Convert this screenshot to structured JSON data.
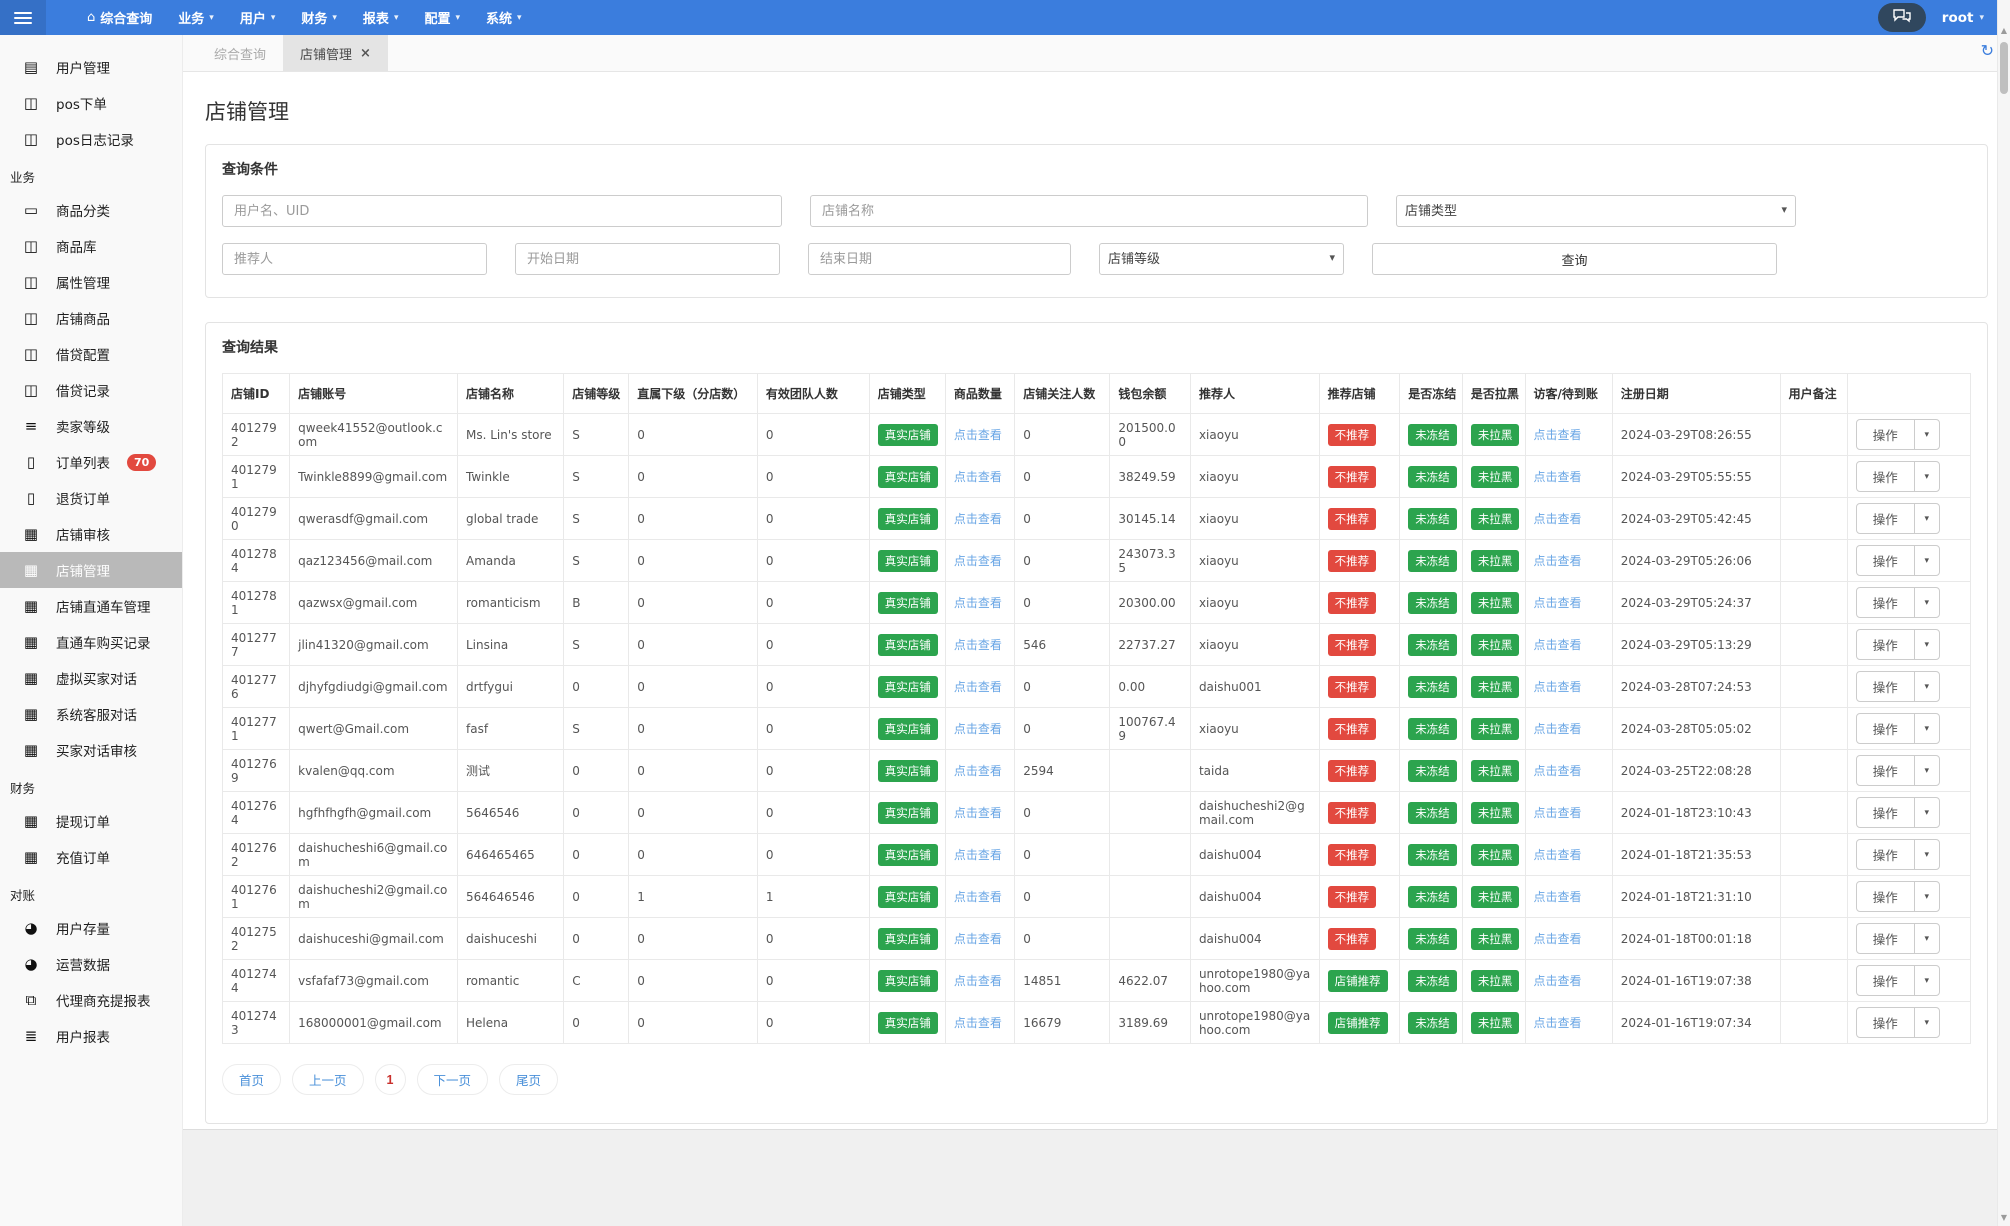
{
  "colors": {
    "navbar": "#3b7ddd",
    "badge_green": "#2ca44e",
    "badge_red": "#e2493f",
    "link": "#69a6e5",
    "pagination_link": "#4a90d9",
    "page_current": "#c9302c"
  },
  "icons": {
    "home": "⌂",
    "caret": "▾",
    "close": "×",
    "refresh": "↻",
    "arrow_up": "▲",
    "arrow_down": "▼",
    "file-icon": "▤",
    "columns-icon": "◫",
    "laptop-icon": "▭",
    "indent-icon": "≡",
    "order-icon": "▯",
    "card-icon": "▦",
    "pie-icon": "◕",
    "sitemap-icon": "⧉",
    "list-icon": "≣"
  },
  "navbar": {
    "menus": [
      {
        "label": "综合查询",
        "icon": "home",
        "caret": false
      },
      {
        "label": "业务",
        "caret": true
      },
      {
        "label": "用户",
        "caret": true
      },
      {
        "label": "财务",
        "caret": true
      },
      {
        "label": "报表",
        "caret": true
      },
      {
        "label": "配置",
        "caret": true
      },
      {
        "label": "系统",
        "caret": true
      }
    ],
    "user": "root"
  },
  "sidebar": {
    "items": [
      {
        "type": "item",
        "icon": "file-icon",
        "label": "用户管理"
      },
      {
        "type": "item",
        "icon": "columns-icon",
        "label": "pos下单"
      },
      {
        "type": "item",
        "icon": "columns-icon",
        "label": "pos日志记录"
      },
      {
        "type": "section",
        "label": "业务"
      },
      {
        "type": "item",
        "icon": "laptop-icon",
        "label": "商品分类"
      },
      {
        "type": "item",
        "icon": "columns-icon",
        "label": "商品库"
      },
      {
        "type": "item",
        "icon": "columns-icon",
        "label": "属性管理"
      },
      {
        "type": "item",
        "icon": "columns-icon",
        "label": "店铺商品"
      },
      {
        "type": "item",
        "icon": "columns-icon",
        "label": "借贷配置"
      },
      {
        "type": "item",
        "icon": "columns-icon",
        "label": "借贷记录"
      },
      {
        "type": "item",
        "icon": "indent-icon",
        "label": "卖家等级"
      },
      {
        "type": "item",
        "icon": "order-icon",
        "label": "订单列表",
        "badge": "70"
      },
      {
        "type": "item",
        "icon": "order-icon",
        "label": "退货订单"
      },
      {
        "type": "item",
        "icon": "card-icon",
        "label": "店铺审核"
      },
      {
        "type": "item",
        "icon": "card-icon",
        "label": "店铺管理",
        "active": true
      },
      {
        "type": "item",
        "icon": "card-icon",
        "label": "店铺直通车管理"
      },
      {
        "type": "item",
        "icon": "card-icon",
        "label": "直通车购买记录"
      },
      {
        "type": "item",
        "icon": "card-icon",
        "label": "虚拟买家对话"
      },
      {
        "type": "item",
        "icon": "card-icon",
        "label": "系统客服对话"
      },
      {
        "type": "item",
        "icon": "card-icon",
        "label": "买家对话审核"
      },
      {
        "type": "section",
        "label": "财务"
      },
      {
        "type": "item",
        "icon": "card-icon",
        "label": "提现订单"
      },
      {
        "type": "item",
        "icon": "card-icon",
        "label": "充值订单"
      },
      {
        "type": "section",
        "label": "对账"
      },
      {
        "type": "item",
        "icon": "pie-icon",
        "label": "用户存量"
      },
      {
        "type": "item",
        "icon": "pie-icon",
        "label": "运营数据"
      },
      {
        "type": "item",
        "icon": "sitemap-icon",
        "label": "代理商充提报表"
      },
      {
        "type": "item",
        "icon": "list-icon",
        "label": "用户报表"
      }
    ]
  },
  "tabs": [
    {
      "label": "综合查询",
      "active": false,
      "closable": false
    },
    {
      "label": "店铺管理",
      "active": true,
      "closable": true
    }
  ],
  "page": {
    "title": "店铺管理"
  },
  "filters": {
    "panel_title": "查询条件",
    "user_placeholder": "用户名、UID",
    "shop_name_placeholder": "店铺名称",
    "type_select": "店铺类型",
    "referrer_placeholder": "推荐人",
    "start_date_placeholder": "开始日期",
    "end_date_placeholder": "结束日期",
    "level_select": "店铺等级",
    "search_label": "查询"
  },
  "results": {
    "panel_title": "查询结果",
    "columns": [
      "店铺ID",
      "店铺账号",
      "店铺名称",
      "店铺等级",
      "直属下级（分店数）",
      "有效团队人数",
      "店铺类型",
      "商品数量",
      "店铺关注人数",
      "钱包余额",
      "推荐人",
      "推荐店铺",
      "是否冻结",
      "是否拉黑",
      "访客/待到账",
      "注册日期",
      "用户备注",
      ""
    ],
    "action_label": "操作",
    "rows": [
      {
        "id": "4012792",
        "account": "qweek41552@outlook.com",
        "name": "Ms. Lin's store",
        "level": "S",
        "direct": "0",
        "team": "0",
        "type": "真实店铺",
        "goods": "点击查看",
        "followers": "0",
        "balance": "201500.00",
        "referrer": "xiaoyu",
        "recommend": "不推荐",
        "recommend_color": "red",
        "frozen": "未冻结",
        "blacklist": "未拉黑",
        "visitor": "点击查看",
        "reg": "2024-03-29T08:26:55",
        "remark": ""
      },
      {
        "id": "4012791",
        "account": "Twinkle8899@gmail.com",
        "name": "Twinkle",
        "level": "S",
        "direct": "0",
        "team": "0",
        "type": "真实店铺",
        "goods": "点击查看",
        "followers": "0",
        "balance": "38249.59",
        "referrer": "xiaoyu",
        "recommend": "不推荐",
        "recommend_color": "red",
        "frozen": "未冻结",
        "blacklist": "未拉黑",
        "visitor": "点击查看",
        "reg": "2024-03-29T05:55:55",
        "remark": ""
      },
      {
        "id": "4012790",
        "account": "qwerasdf@gmail.com",
        "name": "global trade",
        "level": "S",
        "direct": "0",
        "team": "0",
        "type": "真实店铺",
        "goods": "点击查看",
        "followers": "0",
        "balance": "30145.14",
        "referrer": "xiaoyu",
        "recommend": "不推荐",
        "recommend_color": "red",
        "frozen": "未冻结",
        "blacklist": "未拉黑",
        "visitor": "点击查看",
        "reg": "2024-03-29T05:42:45",
        "remark": ""
      },
      {
        "id": "4012784",
        "account": "qaz123456@mail.com",
        "name": "Amanda",
        "level": "S",
        "direct": "0",
        "team": "0",
        "type": "真实店铺",
        "goods": "点击查看",
        "followers": "0",
        "balance": "243073.35",
        "referrer": "xiaoyu",
        "recommend": "不推荐",
        "recommend_color": "red",
        "frozen": "未冻结",
        "blacklist": "未拉黑",
        "visitor": "点击查看",
        "reg": "2024-03-29T05:26:06",
        "remark": ""
      },
      {
        "id": "4012781",
        "account": "qazwsx@gmail.com",
        "name": "romanticism",
        "level": "B",
        "direct": "0",
        "team": "0",
        "type": "真实店铺",
        "goods": "点击查看",
        "followers": "0",
        "balance": "20300.00",
        "referrer": "xiaoyu",
        "recommend": "不推荐",
        "recommend_color": "red",
        "frozen": "未冻结",
        "blacklist": "未拉黑",
        "visitor": "点击查看",
        "reg": "2024-03-29T05:24:37",
        "remark": ""
      },
      {
        "id": "4012777",
        "account": "jlin41320@gmail.com",
        "name": "Linsina",
        "level": "S",
        "direct": "0",
        "team": "0",
        "type": "真实店铺",
        "goods": "点击查看",
        "followers": "546",
        "balance": "22737.27",
        "referrer": "xiaoyu",
        "recommend": "不推荐",
        "recommend_color": "red",
        "frozen": "未冻结",
        "blacklist": "未拉黑",
        "visitor": "点击查看",
        "reg": "2024-03-29T05:13:29",
        "remark": ""
      },
      {
        "id": "4012776",
        "account": "djhyfgdiudgi@gmail.com",
        "name": "drtfygui",
        "level": "0",
        "direct": "0",
        "team": "0",
        "type": "真实店铺",
        "goods": "点击查看",
        "followers": "0",
        "balance": "0.00",
        "referrer": "daishu001",
        "recommend": "不推荐",
        "recommend_color": "red",
        "frozen": "未冻结",
        "blacklist": "未拉黑",
        "visitor": "点击查看",
        "reg": "2024-03-28T07:24:53",
        "remark": ""
      },
      {
        "id": "4012771",
        "account": "qwert@Gmail.com",
        "name": "fasf",
        "level": "S",
        "direct": "0",
        "team": "0",
        "type": "真实店铺",
        "goods": "点击查看",
        "followers": "0",
        "balance": "100767.49",
        "referrer": "xiaoyu",
        "recommend": "不推荐",
        "recommend_color": "red",
        "frozen": "未冻结",
        "blacklist": "未拉黑",
        "visitor": "点击查看",
        "reg": "2024-03-28T05:05:02",
        "remark": ""
      },
      {
        "id": "4012769",
        "account": "kvalen@qq.com",
        "name": "测试",
        "level": "0",
        "direct": "0",
        "team": "0",
        "type": "真实店铺",
        "goods": "点击查看",
        "followers": "2594",
        "balance": "",
        "referrer": "taida",
        "recommend": "不推荐",
        "recommend_color": "red",
        "frozen": "未冻结",
        "blacklist": "未拉黑",
        "visitor": "点击查看",
        "reg": "2024-03-25T22:08:28",
        "remark": ""
      },
      {
        "id": "4012764",
        "account": "hgfhfhgfh@gmail.com",
        "name": "5646546",
        "level": "0",
        "direct": "0",
        "team": "0",
        "type": "真实店铺",
        "goods": "点击查看",
        "followers": "0",
        "balance": "",
        "referrer": "daishucheshi2@gmail.com",
        "recommend": "不推荐",
        "recommend_color": "red",
        "frozen": "未冻结",
        "blacklist": "未拉黑",
        "visitor": "点击查看",
        "reg": "2024-01-18T23:10:43",
        "remark": ""
      },
      {
        "id": "4012762",
        "account": "daishucheshi6@gmail.com",
        "name": "646465465",
        "level": "0",
        "direct": "0",
        "team": "0",
        "type": "真实店铺",
        "goods": "点击查看",
        "followers": "0",
        "balance": "",
        "referrer": "daishu004",
        "recommend": "不推荐",
        "recommend_color": "red",
        "frozen": "未冻结",
        "blacklist": "未拉黑",
        "visitor": "点击查看",
        "reg": "2024-01-18T21:35:53",
        "remark": ""
      },
      {
        "id": "4012761",
        "account": "daishucheshi2@gmail.com",
        "name": "564646546",
        "level": "0",
        "direct": "1",
        "team": "1",
        "type": "真实店铺",
        "goods": "点击查看",
        "followers": "0",
        "balance": "",
        "referrer": "daishu004",
        "recommend": "不推荐",
        "recommend_color": "red",
        "frozen": "未冻结",
        "blacklist": "未拉黑",
        "visitor": "点击查看",
        "reg": "2024-01-18T21:31:10",
        "remark": ""
      },
      {
        "id": "4012752",
        "account": "daishuceshi@gmail.com",
        "name": "daishuceshi",
        "level": "0",
        "direct": "0",
        "team": "0",
        "type": "真实店铺",
        "goods": "点击查看",
        "followers": "0",
        "balance": "",
        "referrer": "daishu004",
        "recommend": "不推荐",
        "recommend_color": "red",
        "frozen": "未冻结",
        "blacklist": "未拉黑",
        "visitor": "点击查看",
        "reg": "2024-01-18T00:01:18",
        "remark": ""
      },
      {
        "id": "4012744",
        "account": "vsfafaf73@gmail.com",
        "name": "romantic",
        "level": "C",
        "direct": "0",
        "team": "0",
        "type": "真实店铺",
        "goods": "点击查看",
        "followers": "14851",
        "balance": "4622.07",
        "referrer": "unrotope1980@yahoo.com",
        "recommend": "店铺推荐",
        "recommend_color": "green",
        "frozen": "未冻结",
        "blacklist": "未拉黑",
        "visitor": "点击查看",
        "reg": "2024-01-16T19:07:38",
        "remark": ""
      },
      {
        "id": "4012743",
        "account": "168000001@gmail.com",
        "name": "Helena",
        "level": "0",
        "direct": "0",
        "team": "0",
        "type": "真实店铺",
        "goods": "点击查看",
        "followers": "16679",
        "balance": "3189.69",
        "referrer": "unrotope1980@yahoo.com",
        "recommend": "店铺推荐",
        "recommend_color": "green",
        "frozen": "未冻结",
        "blacklist": "未拉黑",
        "visitor": "点击查看",
        "reg": "2024-01-16T19:07:34",
        "remark": ""
      }
    ],
    "pagination": [
      {
        "name": "page-first",
        "label": "首页"
      },
      {
        "name": "page-prev",
        "label": "上一页"
      },
      {
        "name": "page-current",
        "label": "1",
        "current": true
      },
      {
        "name": "page-next",
        "label": "下一页"
      },
      {
        "name": "page-last",
        "label": "尾页"
      }
    ]
  }
}
